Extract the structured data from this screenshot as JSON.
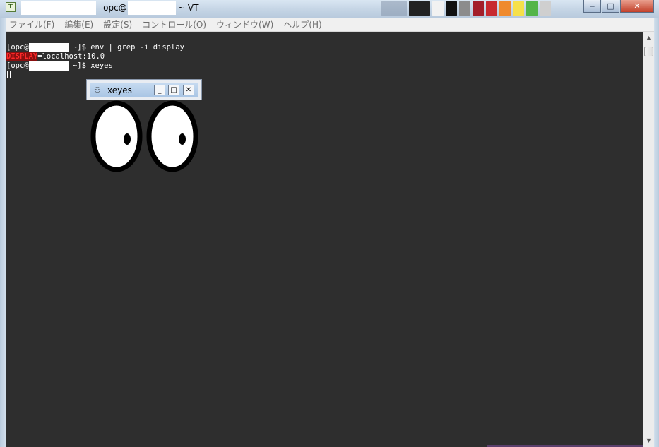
{
  "window": {
    "title_prefix": "- opc@",
    "title_suffix": "~ VT",
    "app_icon_letter": "T",
    "minimize_glyph": "‒",
    "maximize_glyph": "□",
    "close_glyph": "✕"
  },
  "menu": {
    "items": [
      "ファイル(F)",
      "編集(E)",
      "設定(S)",
      "コントロール(O)",
      "ウィンドウ(W)",
      "ヘルプ(H)"
    ]
  },
  "terminal": {
    "line1": {
      "prefix": "[opc@",
      "suffix": " ~]$ env | grep -i display"
    },
    "line2": {
      "highlight": "DISPLAY",
      "rest": "=localhost:10.0"
    },
    "line3": {
      "prefix": "[opc@",
      "suffix": " ~]$ xeyes"
    }
  },
  "xeyes": {
    "title": "xeyes",
    "minimize_glyph": "_",
    "maximize_glyph": "□",
    "close_glyph": "✕"
  },
  "scrollbar": {
    "up_glyph": "▲",
    "down_glyph": "▼"
  },
  "colors": {
    "terminal_bg": "#2e2e2e",
    "terminal_fg": "#ffffff",
    "highlight_fg": "#ff2a2a",
    "highlight_bg": "#8a1010"
  }
}
